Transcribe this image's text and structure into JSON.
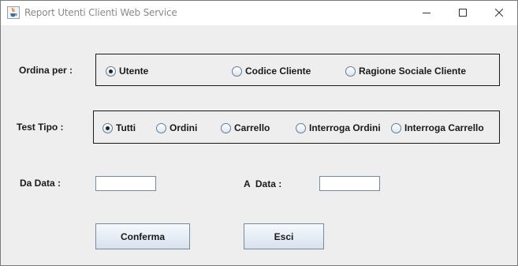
{
  "window": {
    "title": "Report Utenti Clienti Web Service",
    "icons": {
      "app": "java-cup-icon",
      "minimize": "minimize-icon",
      "maximize": "maximize-icon",
      "close": "close-icon"
    }
  },
  "ordina": {
    "label": "Ordina per :",
    "options": [
      {
        "label": "Utente",
        "selected": true
      },
      {
        "label": "Codice Cliente",
        "selected": false
      },
      {
        "label": "Ragione Sociale Cliente",
        "selected": false
      }
    ]
  },
  "test_tipo": {
    "label": "Test Tipo :",
    "options": [
      {
        "label": "Tutti",
        "selected": true
      },
      {
        "label": "Ordini",
        "selected": false
      },
      {
        "label": "Carrello",
        "selected": false
      },
      {
        "label": "Interroga Ordini",
        "selected": false
      },
      {
        "label": "Interroga Carrello",
        "selected": false
      }
    ]
  },
  "dates": {
    "da_label": "Da Data :",
    "da_value": "",
    "a_label": "A  Data :",
    "a_value": ""
  },
  "buttons": {
    "conferma": "Conferma",
    "esci": "Esci"
  }
}
